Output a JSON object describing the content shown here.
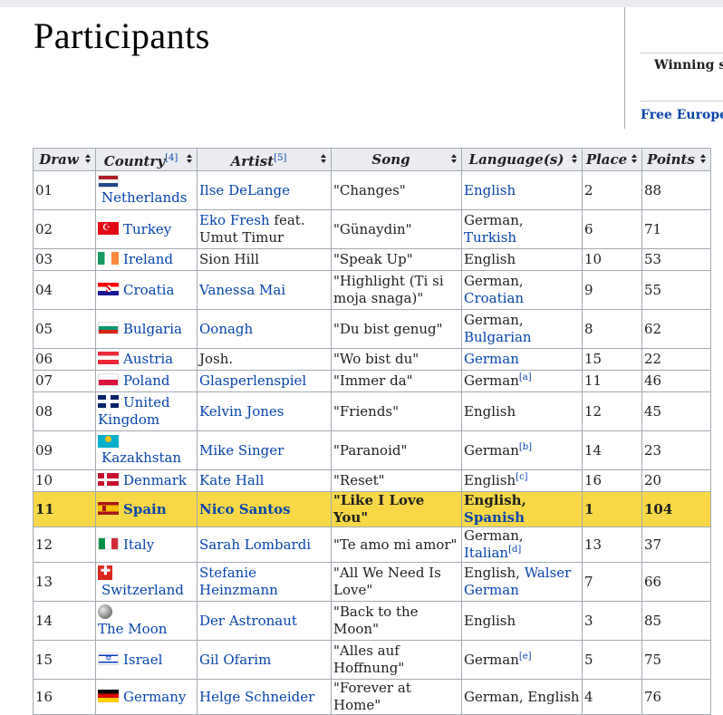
{
  "page": {
    "heading": "Participants",
    "sidebar": {
      "winning": "Winning so",
      "free": "Free Europea"
    }
  },
  "table": {
    "headers": {
      "draw": "Draw",
      "country": "Country",
      "country_note": "[4]",
      "artist": "Artist",
      "artist_note": "[5]",
      "song": "Song",
      "language": "Language(s)",
      "place": "Place",
      "points": "Points"
    },
    "rows": [
      {
        "draw": "01",
        "flag": "nl",
        "country": "Netherlands",
        "artist": "Ilse DeLange",
        "artist_extra": "",
        "song": "\"Changes\"",
        "language": [
          {
            "t": "English",
            "link": true
          }
        ],
        "note": "",
        "place": "2",
        "points": "88"
      },
      {
        "draw": "02",
        "flag": "tr",
        "country": "Turkey",
        "artist": "Eko Fresh",
        "artist_extra": " feat. Umut Timur",
        "song": "\"Günaydin\"",
        "language": [
          {
            "t": "German, ",
            "link": false
          },
          {
            "t": "Turkish",
            "link": true
          }
        ],
        "note": "",
        "place": "6",
        "points": "71"
      },
      {
        "draw": "03",
        "flag": "ie",
        "country": "Ireland",
        "artist": "Sion Hill",
        "artist_plain": true,
        "artist_extra": "",
        "song": "\"Speak Up\"",
        "language": [
          {
            "t": "English",
            "link": false
          }
        ],
        "note": "",
        "place": "10",
        "points": "53"
      },
      {
        "draw": "04",
        "flag": "hr",
        "country": "Croatia",
        "artist": "Vanessa Mai",
        "artist_extra": "",
        "song": "\"Highlight (Ti si moja snaga)\"",
        "language": [
          {
            "t": "German, ",
            "link": false
          },
          {
            "t": "Croatian",
            "link": true
          }
        ],
        "note": "",
        "place": "9",
        "points": "55"
      },
      {
        "draw": "05",
        "flag": "bg",
        "country": "Bulgaria",
        "artist": "Oonagh",
        "artist_extra": "",
        "song": "\"Du bist genug\"",
        "language": [
          {
            "t": "German, ",
            "link": false
          },
          {
            "t": "Bulgarian",
            "link": true
          }
        ],
        "note": "",
        "place": "8",
        "points": "62"
      },
      {
        "draw": "06",
        "flag": "at",
        "country": "Austria",
        "artist": "Josh.",
        "artist_plain": true,
        "artist_extra": "",
        "song": "\"Wo bist du\"",
        "language": [
          {
            "t": "German",
            "link": true
          }
        ],
        "note": "",
        "place": "15",
        "points": "22"
      },
      {
        "draw": "07",
        "flag": "pl",
        "country": "Poland",
        "artist": "Glasperlenspiel",
        "artist_extra": "",
        "song": "\"Immer da\"",
        "language": [
          {
            "t": "German",
            "link": false
          }
        ],
        "note": "[a]",
        "place": "11",
        "points": "46"
      },
      {
        "draw": "08",
        "flag": "gb",
        "country": "United Kingdom",
        "artist": "Kelvin Jones",
        "artist_extra": "",
        "song": "\"Friends\"",
        "language": [
          {
            "t": "English",
            "link": false
          }
        ],
        "note": "",
        "place": "12",
        "points": "45"
      },
      {
        "draw": "09",
        "flag": "kz",
        "country": "Kazakhstan",
        "artist": "Mike Singer",
        "artist_extra": "",
        "song": "\"Paranoid\"",
        "language": [
          {
            "t": "German",
            "link": false
          }
        ],
        "note": "[b]",
        "place": "14",
        "points": "23"
      },
      {
        "draw": "10",
        "flag": "dk",
        "country": "Denmark",
        "artist": "Kate Hall",
        "artist_extra": "",
        "song": "\"Reset\"",
        "language": [
          {
            "t": "English",
            "link": false
          }
        ],
        "note": "[c]",
        "place": "16",
        "points": "20"
      },
      {
        "draw": "11",
        "flag": "es",
        "country": "Spain",
        "artist": "Nico Santos",
        "artist_extra": "",
        "song": "\"Like I Love You\"",
        "language": [
          {
            "t": "English, ",
            "link": false
          },
          {
            "t": "Spanish",
            "link": true
          }
        ],
        "note": "",
        "place": "1",
        "points": "104",
        "winner": true
      },
      {
        "draw": "12",
        "flag": "it",
        "country": "Italy",
        "artist": "Sarah Lombardi",
        "artist_extra": "",
        "song": "\"Te amo mi amor\"",
        "language": [
          {
            "t": "German, ",
            "link": false
          },
          {
            "t": "Italian",
            "link": true
          }
        ],
        "note": "[d]",
        "place": "13",
        "points": "37"
      },
      {
        "draw": "13",
        "flag": "ch",
        "country": "Switzerland",
        "artist": "Stefanie Heinzmann",
        "artist_extra": "",
        "song": "\"All We Need Is Love\"",
        "language": [
          {
            "t": "English, ",
            "link": false
          },
          {
            "t": "Walser German",
            "link": true
          }
        ],
        "note": "",
        "place": "7",
        "points": "66"
      },
      {
        "draw": "14",
        "flag": "moon",
        "country": "The Moon",
        "artist": "Der Astronaut",
        "artist_extra": "",
        "song": "\"Back to the Moon\"",
        "language": [
          {
            "t": "English",
            "link": false
          }
        ],
        "note": "",
        "place": "3",
        "points": "85"
      },
      {
        "draw": "15",
        "flag": "il",
        "country": "Israel",
        "artist": "Gil Ofarim",
        "artist_extra": "",
        "song": "\"Alles auf Hoffnung\"",
        "language": [
          {
            "t": "German",
            "link": false
          }
        ],
        "note": "[e]",
        "place": "5",
        "points": "75"
      },
      {
        "draw": "16",
        "flag": "de",
        "country": "Germany",
        "artist": "Helge Schneider",
        "artist_extra": "",
        "song": "\"Forever at Home\"",
        "language": [
          {
            "t": "German, English",
            "link": false
          }
        ],
        "note": "",
        "place": "4",
        "points": "76"
      }
    ]
  },
  "colors": {
    "link": "#0645ad",
    "winner_bg": "#f8d846",
    "header_bg": "#eaecf0",
    "border": "#a2a9b1"
  }
}
